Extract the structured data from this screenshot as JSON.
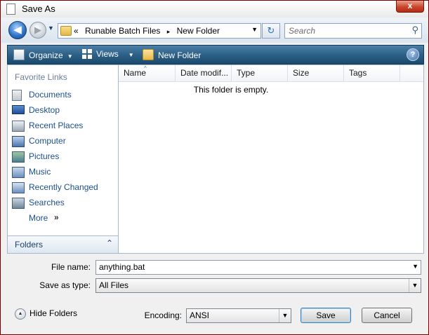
{
  "window": {
    "title": "Save As",
    "close_glyph": "x"
  },
  "address": {
    "chevron": "«",
    "segments": [
      "Runable Batch Files",
      "New Folder"
    ],
    "separator": "▸",
    "back_glyph": "◀",
    "forward_glyph": "▶"
  },
  "search": {
    "placeholder": "Search"
  },
  "toolbar": {
    "organize": "Organize",
    "views": "Views",
    "new_folder": "New Folder",
    "help_glyph": "?"
  },
  "nav": {
    "heading": "Favorite Links",
    "items": [
      {
        "label": "Documents",
        "icon": "documents-icon"
      },
      {
        "label": "Desktop",
        "icon": "desktop-icon"
      },
      {
        "label": "Recent Places",
        "icon": "recent-places-icon"
      },
      {
        "label": "Computer",
        "icon": "computer-icon"
      },
      {
        "label": "Pictures",
        "icon": "pictures-icon"
      },
      {
        "label": "Music",
        "icon": "music-icon"
      },
      {
        "label": "Recently Changed",
        "icon": "recently-changed-icon"
      },
      {
        "label": "Searches",
        "icon": "searches-icon"
      }
    ],
    "more": "More",
    "more_glyph": "»",
    "folders": "Folders"
  },
  "files": {
    "columns": [
      "Name",
      "Date modif...",
      "Type",
      "Size",
      "Tags"
    ],
    "empty_message": "This folder is empty."
  },
  "form": {
    "file_name_label": "File name:",
    "file_name_value": "anything.bat",
    "save_as_type_label": "Save as type:",
    "save_as_type_value": "All Files",
    "encoding_label": "Encoding:",
    "encoding_value": "ANSI"
  },
  "footer": {
    "hide_folders": "Hide Folders",
    "save": "Save",
    "cancel": "Cancel"
  }
}
